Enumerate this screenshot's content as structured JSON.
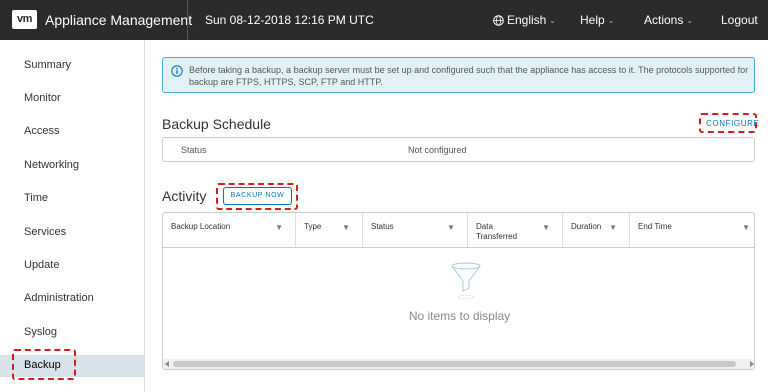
{
  "header": {
    "logo_text": "vm",
    "title": "Appliance Management",
    "datetime": "Sun 08-12-2018 12:16 PM UTC",
    "language": "English",
    "help": "Help",
    "actions": "Actions",
    "logout": "Logout"
  },
  "sidebar": {
    "items": [
      {
        "label": "Summary"
      },
      {
        "label": "Monitor"
      },
      {
        "label": "Access"
      },
      {
        "label": "Networking"
      },
      {
        "label": "Time"
      },
      {
        "label": "Services"
      },
      {
        "label": "Update"
      },
      {
        "label": "Administration"
      },
      {
        "label": "Syslog"
      },
      {
        "label": "Backup"
      }
    ],
    "active": "Backup"
  },
  "alert": {
    "text": "Before taking a backup, a backup server must be set up and configured such that the appliance has access to it. The protocols supported for backup are FTPS, HTTPS, SCP, FTP and HTTP."
  },
  "schedule": {
    "title": "Backup Schedule",
    "configure_label": "CONFIGURE",
    "status_label": "Status",
    "status_value": "Not configured"
  },
  "activity": {
    "title": "Activity",
    "backup_now_label": "BACKUP NOW",
    "columns": [
      {
        "label": "Backup Location"
      },
      {
        "label": "Type"
      },
      {
        "label": "Status"
      },
      {
        "label": "Data Transferred"
      },
      {
        "label": "Duration"
      },
      {
        "label": "End Time"
      }
    ],
    "empty_text": "No items to display"
  },
  "colors": {
    "header_bg": "#2b2b2b",
    "accent": "#0079b8",
    "alert_bg": "#e1f1f6",
    "alert_border": "#49afd9",
    "active_nav_bg": "#d8e3e9",
    "highlight": "#d61d1d"
  }
}
